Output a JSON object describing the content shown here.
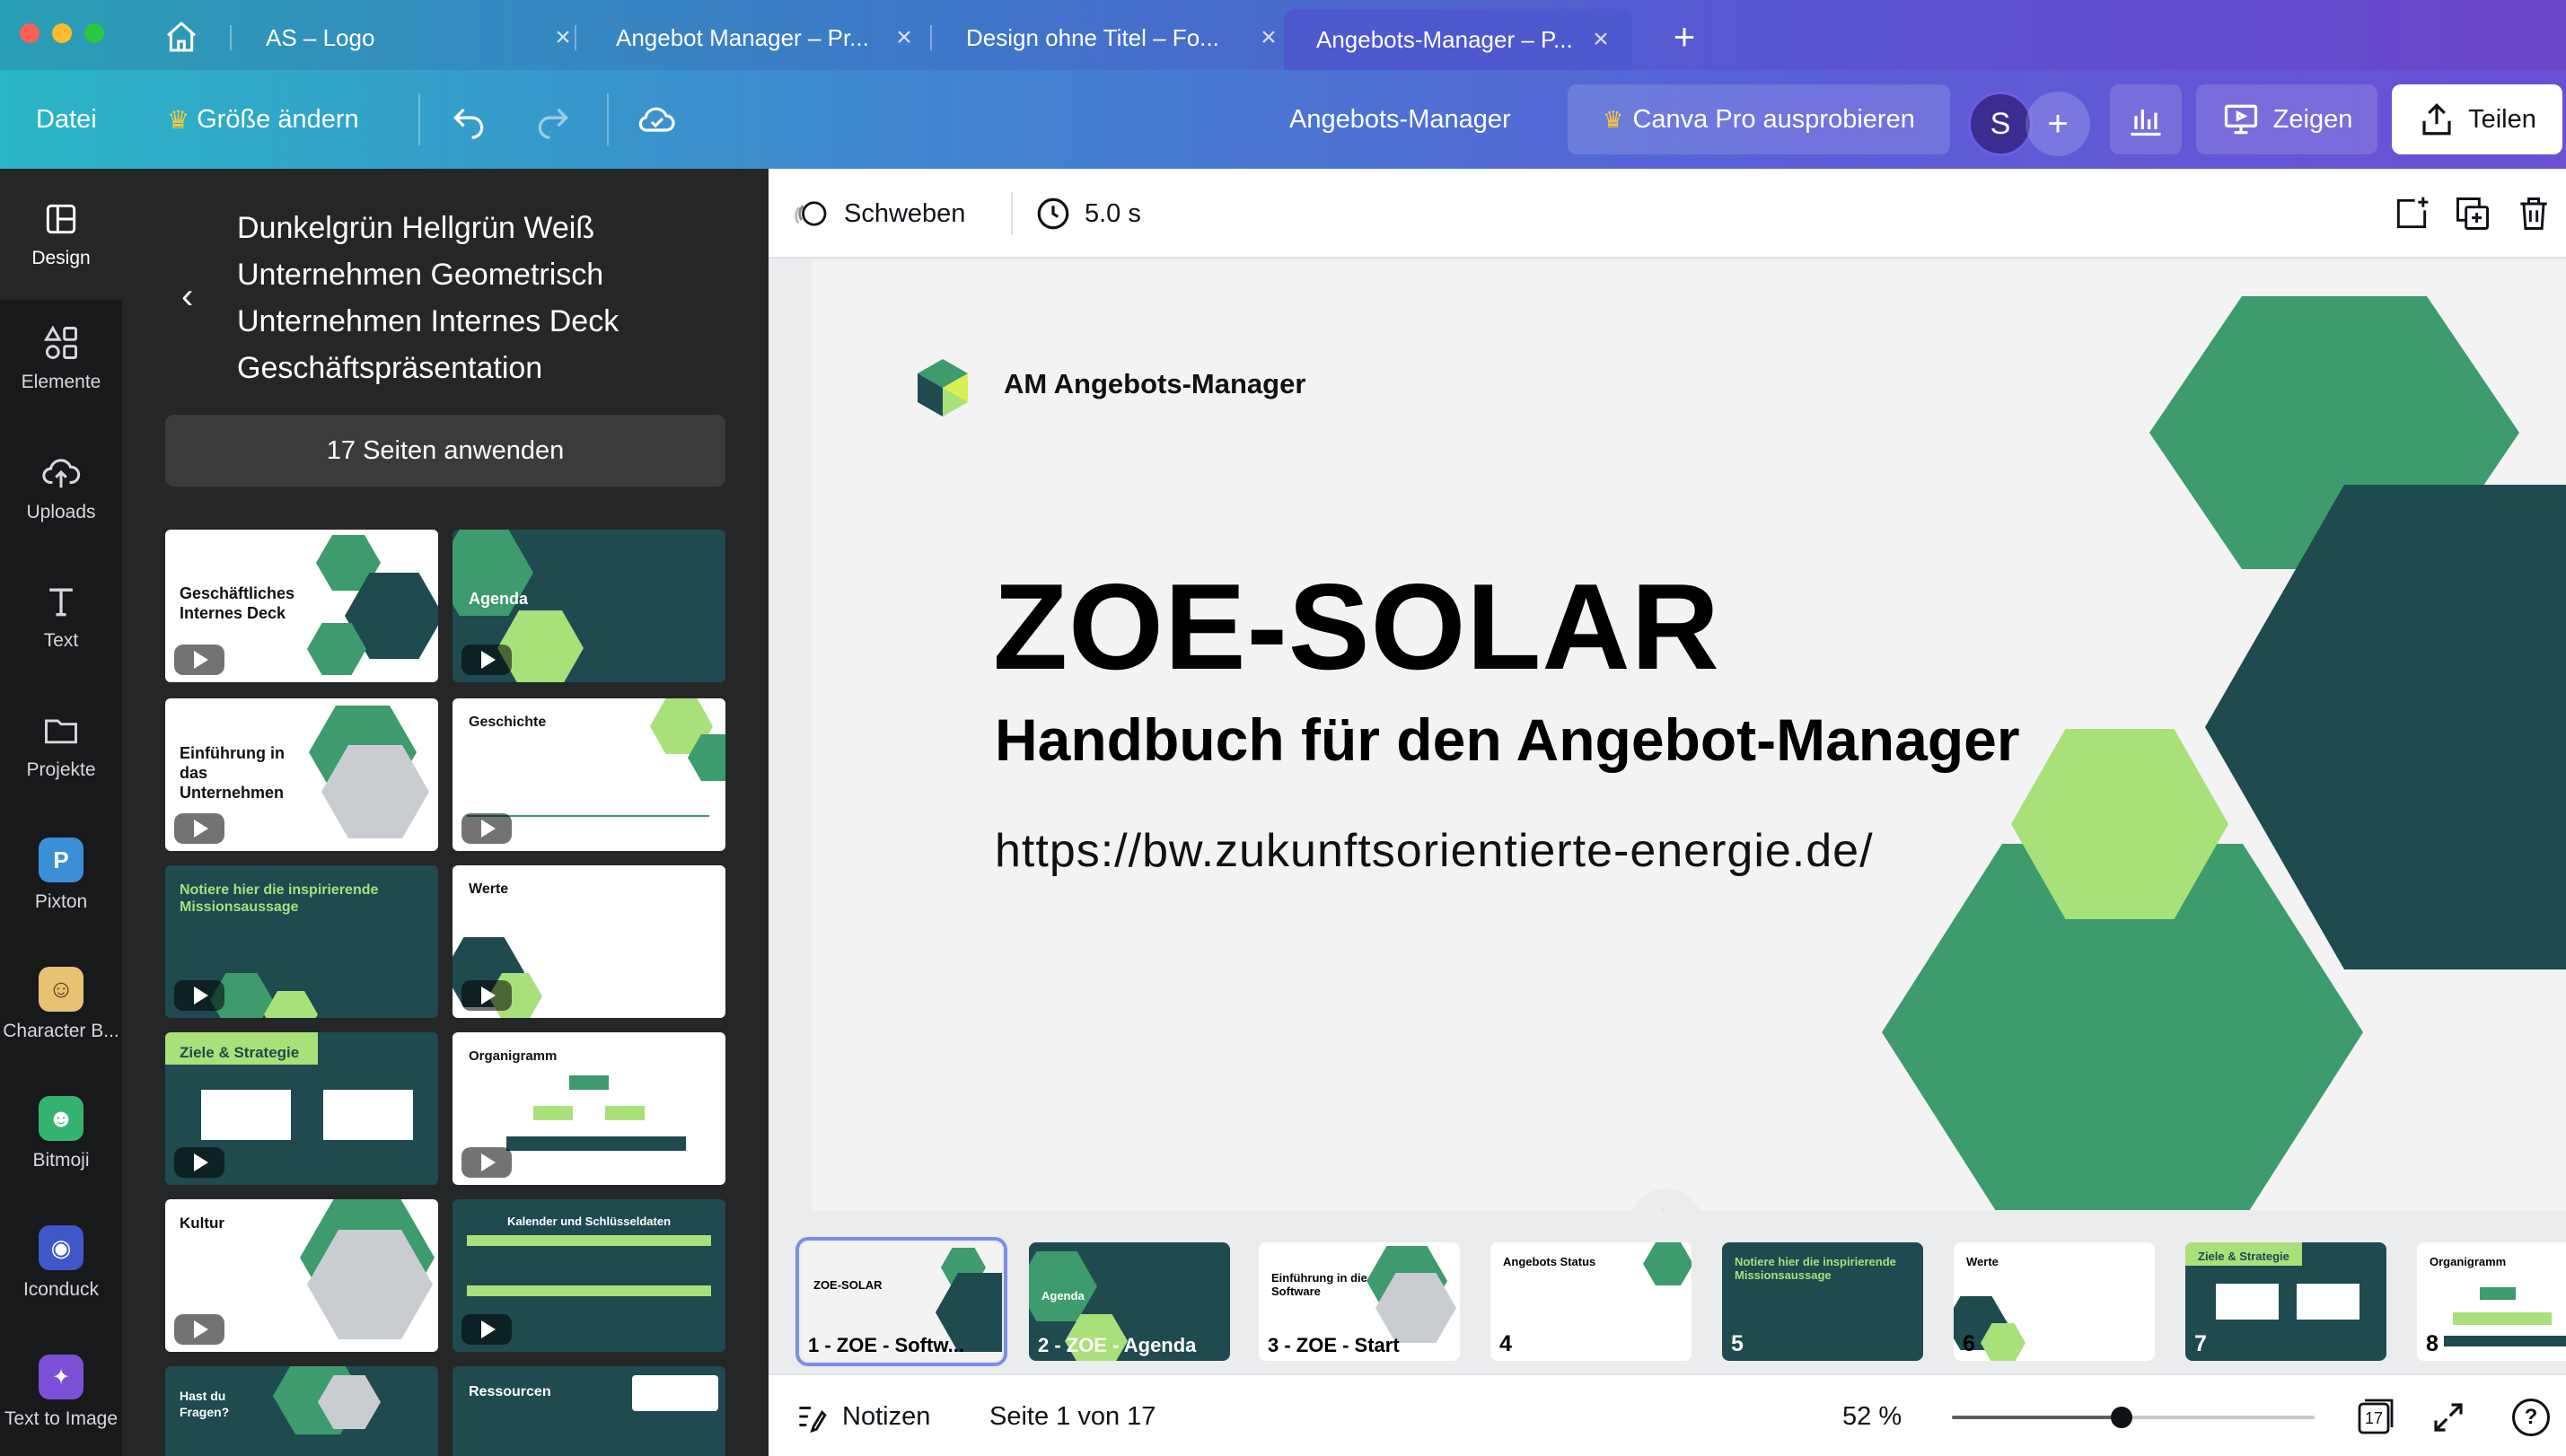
{
  "tabs": [
    {
      "label": "AS – Logo",
      "close": "×"
    },
    {
      "label": "Angebot Manager – Pr...",
      "close": "×"
    },
    {
      "label": "Design ohne Titel – Fo...",
      "close": "×"
    },
    {
      "label": "Angebots-Manager – P...",
      "close": "×"
    }
  ],
  "new_tab": "+",
  "toolbar": {
    "file": "Datei",
    "resize": "Größe ändern",
    "doc_title": "Angebots-Manager",
    "pro": "Canva Pro ausprobieren",
    "avatar_initial": "S",
    "add_member": "+",
    "present": "Zeigen",
    "share": "Teilen"
  },
  "rail": [
    {
      "label": "Design",
      "icon": "layout-icon"
    },
    {
      "label": "Elemente",
      "icon": "shapes-icon"
    },
    {
      "label": "Uploads",
      "icon": "cloud-upload-icon"
    },
    {
      "label": "Text",
      "icon": "text-icon"
    },
    {
      "label": "Projekte",
      "icon": "folder-icon"
    },
    {
      "label": "Pixton",
      "icon": "pixton-app-icon"
    },
    {
      "label": "Character B...",
      "icon": "character-builder-app-icon"
    },
    {
      "label": "Bitmoji",
      "icon": "bitmoji-app-icon"
    },
    {
      "label": "Iconduck",
      "icon": "iconduck-app-icon"
    },
    {
      "label": "Text to Image",
      "icon": "text-to-image-app-icon"
    }
  ],
  "panel": {
    "template_title": "Dunkelgrün Hellgrün Weiß Unternehmen Geometrisch Unternehmen Internes Deck Geschäftspräsentation",
    "apply": "17 Seiten anwenden",
    "thumbs": [
      {
        "title": "Geschäftliches Internes Deck"
      },
      {
        "title": "Agenda"
      },
      {
        "title": "Einführung in das Unternehmen"
      },
      {
        "title": "Geschichte"
      },
      {
        "title": "Notiere hier die inspirierende Missionsaussage"
      },
      {
        "title": "Werte"
      },
      {
        "title": "Ziele & Strategie"
      },
      {
        "title": "Organigramm"
      },
      {
        "title": "Kultur"
      },
      {
        "title": "Kalender und Schlüsseldaten"
      },
      {
        "title": "Hast du Fragen?"
      },
      {
        "title": "Ressourcen"
      }
    ]
  },
  "context_bar": {
    "animation": "Schweben",
    "duration": "5.0 s"
  },
  "slide": {
    "logo_text": "AM Angebots-Manager",
    "title": "ZOE-SOLAR",
    "subtitle": "Handbuch für den Angebot-Manager",
    "url": "https://bw.zukunftsorientierte-energie.de/"
  },
  "filmstrip": [
    {
      "num": "1 - ZOE - Softw...",
      "title": "ZOE-SOLAR"
    },
    {
      "num": "2 - ZOE - Agenda",
      "title": "Agenda"
    },
    {
      "num": "3 - ZOE - Start",
      "title": "Einführung in die Software"
    },
    {
      "num": "4",
      "title": "Angebots Status"
    },
    {
      "num": "5",
      "title": "Notiere hier die inspirierende Missionsaussage"
    },
    {
      "num": "6",
      "title": "Werte"
    },
    {
      "num": "7",
      "title": "Ziele & Strategie"
    },
    {
      "num": "8",
      "title": "Organigramm"
    }
  ],
  "status": {
    "notes": "Notizen",
    "page": "Seite 1 von 17",
    "zoom_value": 52,
    "zoom": "52 %",
    "page_count": "17",
    "help": "?"
  },
  "colors": {
    "dark_teal": "#1e4a50",
    "mid_green": "#3d9b6d",
    "light_green": "#a8e07a",
    "canvas_bg": "#f3f3f3"
  }
}
